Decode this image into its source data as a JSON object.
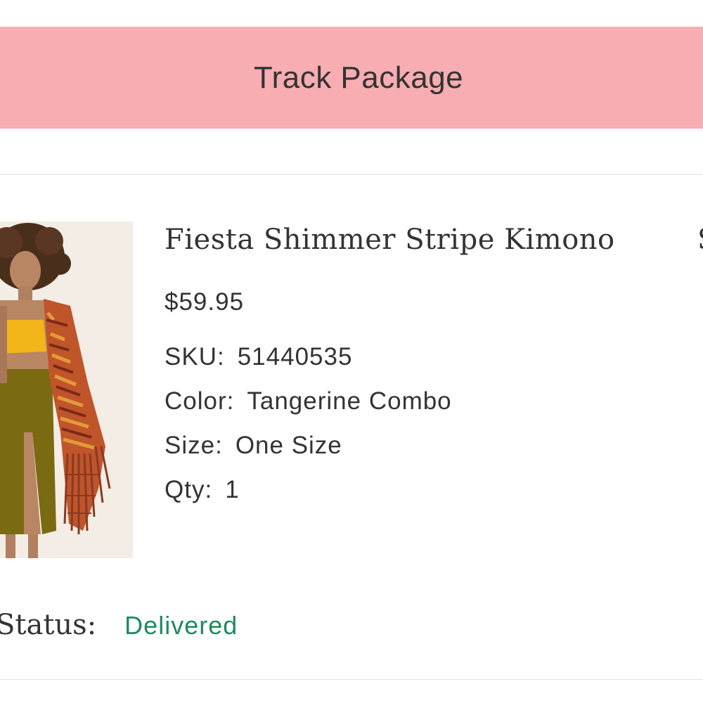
{
  "track_button": {
    "label": "Track Package"
  },
  "product": {
    "title": "Fiesta Shimmer Stripe Kimono",
    "title_overflow": "S",
    "price": "$59.95",
    "sku_label": "SKU:",
    "sku": "51440535",
    "color_label": "Color:",
    "color": "Tangerine Combo",
    "size_label": "Size:",
    "size": "One Size",
    "qty_label": "Qty:",
    "qty": "1",
    "image": "product-photo-model-in-kimono"
  },
  "status": {
    "label": "Status:",
    "value": "Delivered"
  },
  "colors": {
    "track_button_bg": "#f7adb2",
    "status_delivered": "#1f8a5c",
    "text": "#333333"
  }
}
